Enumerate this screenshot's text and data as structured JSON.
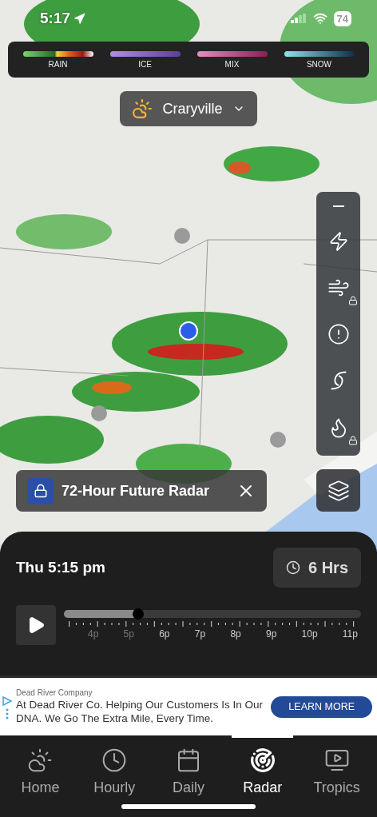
{
  "status_bar": {
    "time": "5:17",
    "battery": "74"
  },
  "legend": [
    {
      "kind": "rain",
      "label": "RAIN"
    },
    {
      "kind": "ice",
      "label": "ICE"
    },
    {
      "kind": "mix",
      "label": "MIX"
    },
    {
      "kind": "snow",
      "label": "SNOW"
    }
  ],
  "location": {
    "name": "Craryville"
  },
  "layer_tools": [
    {
      "kind": "collapse",
      "locked": false
    },
    {
      "kind": "lightning",
      "locked": false
    },
    {
      "kind": "wind",
      "locked": true
    },
    {
      "kind": "alerts",
      "locked": false
    },
    {
      "kind": "hurricane",
      "locked": false
    },
    {
      "kind": "fire",
      "locked": true
    }
  ],
  "promo": {
    "title": "72-Hour Future Radar",
    "locked": true
  },
  "timeline": {
    "time": "Thu 5:15 pm",
    "range": "6 Hrs",
    "level": 0.25,
    "ticks": [
      {
        "label": "4p",
        "past": true
      },
      {
        "label": "5p",
        "past": true
      },
      {
        "label": "6p",
        "past": false
      },
      {
        "label": "7p",
        "past": false
      },
      {
        "label": "8p",
        "past": false
      },
      {
        "label": "9p",
        "past": false
      },
      {
        "label": "10p",
        "past": false
      },
      {
        "label": "11p",
        "past": false
      }
    ]
  },
  "ad": {
    "sponsor": "Dead River Company",
    "text": "At Dead River Co. Helping Our Customers Is In Our DNA. We Go The Extra Mile, Every Time.",
    "button": "LEARN MORE"
  },
  "tabs": [
    {
      "label": "Home",
      "selected": false
    },
    {
      "label": "Hourly",
      "selected": false
    },
    {
      "label": "Daily",
      "selected": false
    },
    {
      "label": "Radar",
      "selected": true
    },
    {
      "label": "Tropics",
      "selected": false
    }
  ]
}
